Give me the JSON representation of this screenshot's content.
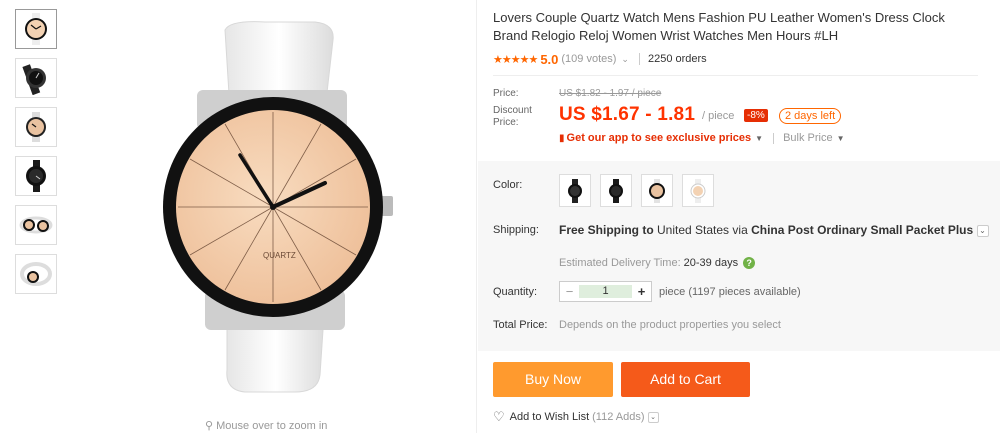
{
  "gallery": {
    "thumbnails": [
      {
        "icon": "watch-peach-face-thumb"
      },
      {
        "icon": "watch-black-thumb"
      },
      {
        "icon": "watch-peach-side-thumb"
      },
      {
        "icon": "watch-black-side-thumb"
      },
      {
        "icon": "watch-pair-thumb"
      },
      {
        "icon": "watch-band-thumb"
      }
    ],
    "zoom_hint": "Mouse over to zoom in",
    "main_watch": {
      "face_label": "QUARTZ",
      "face_color": "#f3d2b3",
      "strap_color": "#f2f2f2",
      "bezel_color": "#111111"
    }
  },
  "product": {
    "title": "Lovers Couple Quartz Watch Mens Fashion PU Leather Women's Dress Clock Brand Relogio Reloj Women Wrist Watches Men Hours #LH",
    "stars": "★★★★★",
    "rating": "5.0",
    "votes": "(109 votes)",
    "orders": "2250 orders"
  },
  "price": {
    "price_label": "Price:",
    "original": "US $1.82 - 1.97 / piece",
    "discount_label_1": "Discount",
    "discount_label_2": "Price:",
    "discount_price": "US $1.67 - 1.81",
    "per_piece": "/ piece",
    "off_badge": "-8%",
    "days_left": "2 days left",
    "app_promo": "Get our app to see exclusive prices",
    "bulk_price": "Bulk Price"
  },
  "options": {
    "color_label": "Color:",
    "colors": [
      "black-watch",
      "black-watch-2",
      "peach-watch",
      "peach-white-watch"
    ],
    "shipping_label": "Shipping:",
    "shipping_bold": "Free Shipping to",
    "shipping_dest": "United States",
    "shipping_via": "via",
    "shipping_method": "China Post Ordinary Small Packet Plus",
    "delivery_label": "Estimated Delivery Time:",
    "delivery_days": "20-39 days",
    "help": "?",
    "quantity_label": "Quantity:",
    "quantity_minus": "−",
    "quantity_value": "1",
    "quantity_plus": "+",
    "quantity_note": "piece (1197 pieces available)",
    "total_label": "Total Price:",
    "total_note": "Depends on the product properties you select"
  },
  "actions": {
    "buy_now": "Buy Now",
    "add_to_cart": "Add to Cart",
    "wish_list": "Add to Wish List",
    "wish_count": "(112 Adds)"
  },
  "colors": {
    "accent": "#f30",
    "buy_now": "#ff9a2e",
    "add_to_cart": "#f55a1a",
    "badge": "#e62e04",
    "help": "#71b247"
  }
}
